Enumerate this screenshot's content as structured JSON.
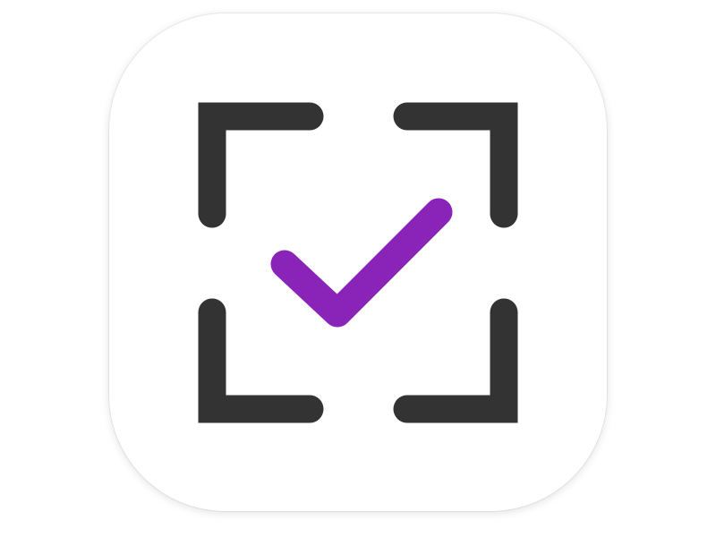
{
  "icon": {
    "name": "scan-check-icon",
    "colors": {
      "background": "#ffffff",
      "frame": "#333333",
      "check": "#8a24b8"
    }
  }
}
